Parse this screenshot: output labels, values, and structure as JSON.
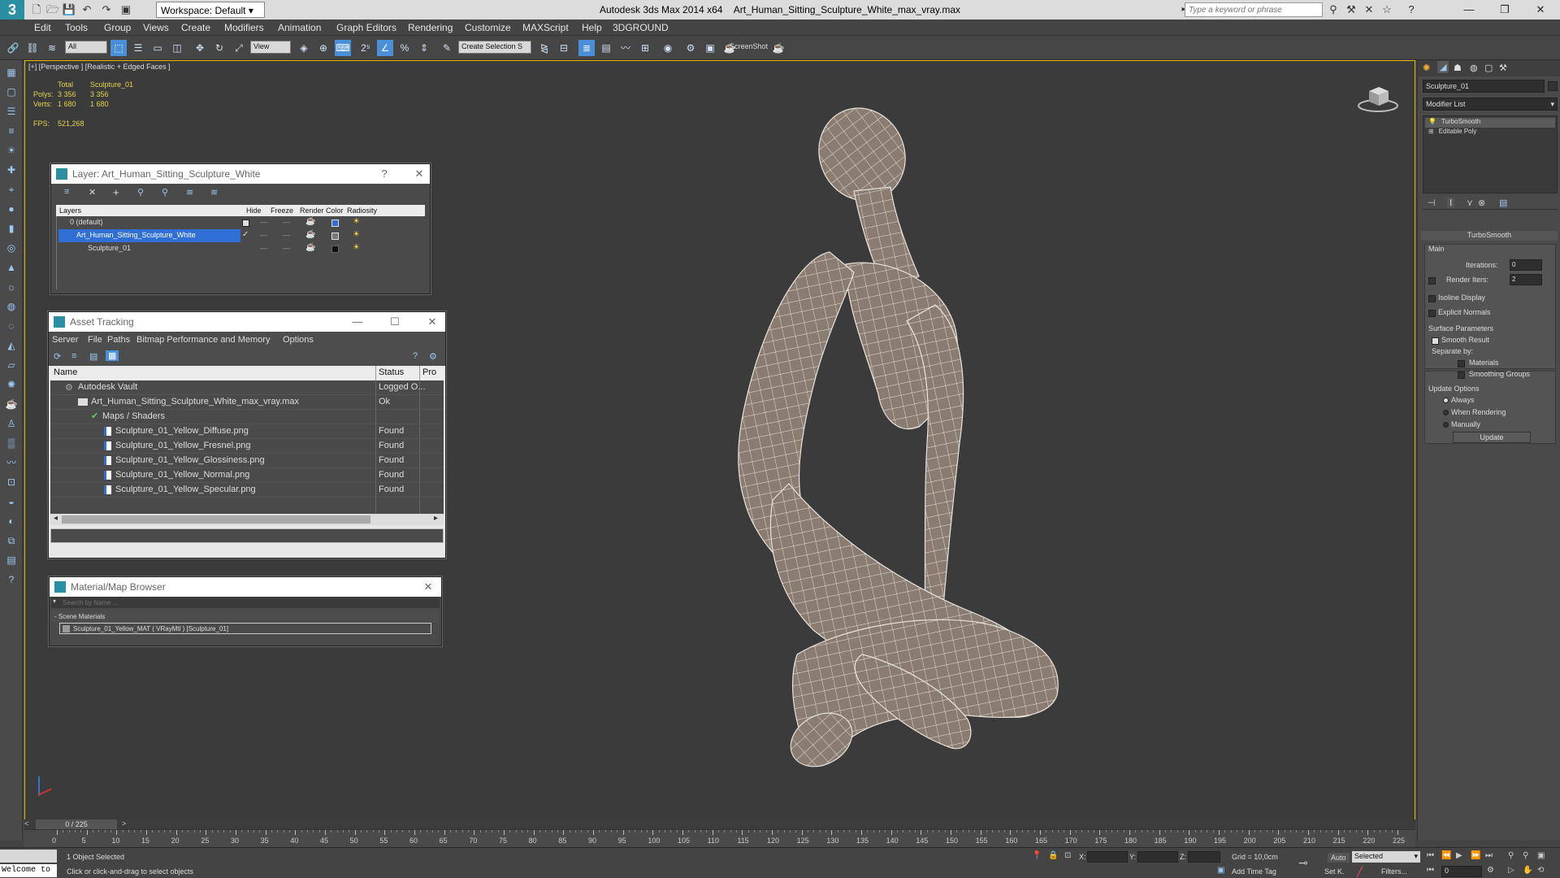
{
  "titlebar": {
    "workspace": "Workspace: Default",
    "app_name": "Autodesk 3ds Max  2014 x64",
    "file_name": "Art_Human_Sitting_Sculpture_White_max_vray.max",
    "search_placeholder": "Type a keyword or phrase"
  },
  "menu": [
    "Edit",
    "Tools",
    "Group",
    "Views",
    "Create",
    "Modifiers",
    "Animation",
    "Graph Editors",
    "Rendering",
    "Customize",
    "MAXScript",
    "Help",
    "3DGROUND"
  ],
  "toolbar": {
    "filter_value": "All",
    "refcoord_value": "View",
    "named_selection": "Create Selection S",
    "screenshot_label": "ScreenShot"
  },
  "viewport": {
    "label": "[+] [Perspective ] [Realistic + Edged Faces ]",
    "stats": {
      "col_total": "Total",
      "col_object": "Sculpture_01",
      "polys_label": "Polys:",
      "polys_total": "3 356",
      "polys_object": "3 356",
      "verts_label": "Verts:",
      "verts_total": "1 680",
      "verts_object": "1 680",
      "fps_label": "FPS:",
      "fps_value": "521,268"
    }
  },
  "layer_dialog": {
    "title": "Layer: Art_Human_Sitting_Sculpture_White",
    "help": "?",
    "columns": [
      "Layers",
      "Hide",
      "Freeze",
      "Render",
      "Color",
      "Radiosity"
    ],
    "rows": [
      {
        "name": "0 (default)",
        "color": "#2f6fd6"
      },
      {
        "name": "Art_Human_Sitting_Sculpture_White",
        "color": "#777777"
      },
      {
        "name": "Sculpture_01",
        "color": "#111111"
      }
    ]
  },
  "asset_tracking": {
    "title": "Asset Tracking",
    "menus": [
      "Server",
      "File",
      "Paths",
      "Bitmap Performance and Memory",
      "Options"
    ],
    "columns": [
      "Name",
      "Status",
      "Pro"
    ],
    "rows": [
      {
        "name": "Autodesk Vault",
        "status": "Logged O..."
      },
      {
        "name": "Art_Human_Sitting_Sculpture_White_max_vray.max",
        "status": "Ok"
      },
      {
        "name": "Maps / Shaders",
        "status": ""
      },
      {
        "name": "Sculpture_01_Yellow_Diffuse.png",
        "status": "Found"
      },
      {
        "name": "Sculpture_01_Yellow_Fresnel.png",
        "status": "Found"
      },
      {
        "name": "Sculpture_01_Yellow_Glossiness.png",
        "status": "Found"
      },
      {
        "name": "Sculpture_01_Yellow_Normal.png",
        "status": "Found"
      },
      {
        "name": "Sculpture_01_Yellow_Specular.png",
        "status": "Found"
      }
    ]
  },
  "material_browser": {
    "title": "Material/Map Browser",
    "search_placeholder": "Search by Name ...",
    "group": "- Scene Materials",
    "item": "Sculpture_01_Yellow_MAT ( VRayMtl ) [Sculpture_01]"
  },
  "command_panel": {
    "object_name": "Sculpture_01",
    "modifier_list": "Modifier List",
    "stack": [
      "TurboSmooth",
      "Editable Poly"
    ],
    "rollout_title": "TurboSmooth",
    "main_label": "Main",
    "iterations_label": "Iterations:",
    "iterations_value": "0",
    "render_iters_label": "Render Iters:",
    "render_iters_value": "2",
    "isoline": "Isoline Display",
    "explicit_normals": "Explicit Normals",
    "surface_params": "Surface Parameters",
    "smooth_result": "Smooth Result",
    "separate_by": "Separate by:",
    "materials": "Materials",
    "smoothing_groups": "Smoothing Groups",
    "update_options": "Update Options",
    "always": "Always",
    "when_rendering": "When Rendering",
    "manually": "Manually",
    "update_button": "Update"
  },
  "timeline": {
    "frame": "0 / 225",
    "ticks": [
      "0",
      "5",
      "10",
      "15",
      "20",
      "25",
      "30",
      "35",
      "40",
      "45",
      "50",
      "55",
      "60",
      "65",
      "70",
      "75",
      "80",
      "85",
      "90",
      "95",
      "100",
      "105",
      "110",
      "115",
      "120",
      "125",
      "130",
      "135",
      "140",
      "145",
      "150",
      "155",
      "160",
      "165",
      "170",
      "175",
      "180",
      "185",
      "190",
      "195",
      "200",
      "205",
      "210",
      "215",
      "220",
      "225"
    ]
  },
  "status": {
    "welcome": "Welcome to",
    "selection": "1 Object Selected",
    "prompt": "Click or click-and-drag to select objects",
    "x": "X:",
    "y": "Y:",
    "z": "Z:",
    "grid": "Grid = 10,0cm",
    "add_time_tag": "Add Time Tag",
    "auto": "Auto",
    "set_k": "Set K.",
    "selected": "Selected",
    "filters": "Filters...",
    "frame_value": "0"
  }
}
